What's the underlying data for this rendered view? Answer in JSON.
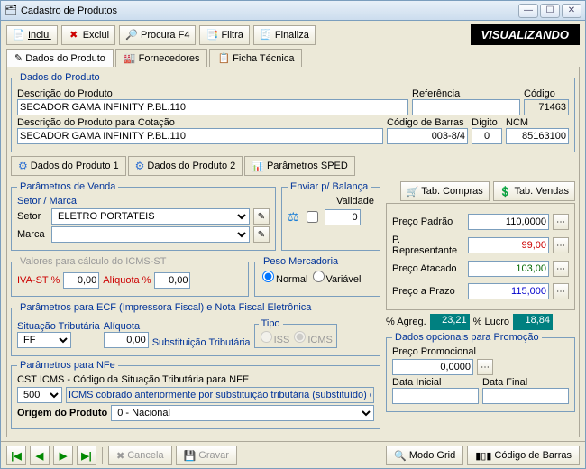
{
  "window": {
    "title": "Cadastro de Produtos"
  },
  "toolbar": {
    "inclui": "Inclui",
    "exclui": "Exclui",
    "procura": "Procura F4",
    "filtra": "Filtra",
    "finaliza": "Finaliza"
  },
  "mode": "VISUALIZANDO",
  "mainTabs": {
    "dados": "Dados do Produto",
    "fornecedores": "Fornecedores",
    "ficha": "Ficha Técnica"
  },
  "dadosProduto": {
    "legend": "Dados do Produto",
    "descricaoLabel": "Descrição do Produto",
    "descricao": "SECADOR GAMA INFINITY P.BL.110",
    "descricaoCotLabel": "Descrição do Produto para Cotação",
    "descricaoCot": "SECADOR GAMA INFINITY P.BL.110",
    "referenciaLabel": "Referência",
    "referencia": "",
    "codigoLabel": "Código",
    "codigo": "71463",
    "codBarrasLabel": "Código de Barras",
    "codBarras": "003-8/4",
    "digitoLabel": "Dígito",
    "digito": "0",
    "ncmLabel": "NCM",
    "ncm": "85163100"
  },
  "subTabs": {
    "dados1": "Dados do Produto 1",
    "dados2": "Dados do Produto 2",
    "sped": "Parâmetros SPED"
  },
  "paramVenda": {
    "legend": "Parâmetros de Venda",
    "setorMarcaLabel": "Setor / Marca",
    "setorLabel": "Setor",
    "setor": "ELETRO PORTATEIS",
    "marcaLabel": "Marca",
    "marca": ""
  },
  "balanca": {
    "legend": "Enviar p/ Balança",
    "validadeLabel": "Validade",
    "validade": "0"
  },
  "icmsst": {
    "legend": "Valores para cálculo do ICMS-ST",
    "ivaLabel": "IVA-ST %",
    "iva": "0,00",
    "aliqLabel": "Alíquota %",
    "aliq": "0,00"
  },
  "peso": {
    "legend": "Peso Mercadoria",
    "normal": "Normal",
    "variavel": "Variável"
  },
  "ecf": {
    "legend": "Parâmetros para ECF (Impressora Fiscal) e Nota Fiscal Eletrônica",
    "sitLabel": "Situação Tributária",
    "sit": "FF",
    "aliqLabel": "Alíquota",
    "aliq": "0,00",
    "substLabel": "Substituição Tributária",
    "tipoLegend": "Tipo",
    "iss": "ISS",
    "icms": "ICMS"
  },
  "nfe": {
    "legend": "Parâmetros para NFe",
    "cstLabel": "CST ICMS - Código da Situação Tributária para NFE",
    "cstCode": "500",
    "cstDesc": "ICMS cobrado anteriormente por substituição tributária (substituído) ou por",
    "origemLabel": "Origem do Produto",
    "origem": "0 - Nacional"
  },
  "tabButtons": {
    "compras": "Tab. Compras",
    "vendas": "Tab. Vendas"
  },
  "precos": {
    "padraoLabel": "Preço Padrão",
    "padrao": "110,0000",
    "repLabel": "P. Representante",
    "rep": "99,00",
    "atacLabel": "Preço Atacado",
    "atac": "103,00",
    "prazoLabel": "Preço a Prazo",
    "prazo": "115,000"
  },
  "metrics": {
    "agregLabel": "% Agreg.",
    "agreg": "23,21",
    "lucroLabel": "% Lucro",
    "lucro": "18,84"
  },
  "promo": {
    "legend": "Dados opcionais para Promoção",
    "precoLabel": "Preço Promocional",
    "preco": "0,0000",
    "dataIniLabel": "Data Inicial",
    "dataIni": "",
    "dataFimLabel": "Data Final",
    "dataFim": ""
  },
  "footer": {
    "cancela": "Cancela",
    "gravar": "Gravar",
    "modoGrid": "Modo Grid",
    "codBarras": "Código de Barras"
  }
}
